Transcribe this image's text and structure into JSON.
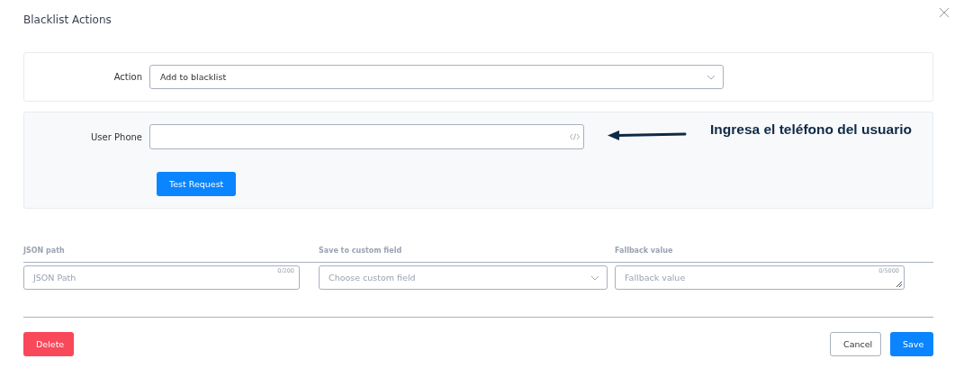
{
  "dialog": {
    "title": "Blacklist Actions"
  },
  "action": {
    "label": "Action",
    "value": "Add to blacklist"
  },
  "request": {
    "label": "User Phone",
    "button": "Test Request",
    "annotation": "Ingresa el teléfono del usuario"
  },
  "mapping": {
    "columns": [
      {
        "kind": "text",
        "label": "JSON path",
        "placeholder": "JSON Path",
        "counter": "0/200"
      },
      {
        "kind": "select",
        "label": "Save to custom field",
        "placeholder": "Choose custom field"
      },
      {
        "kind": "textarea",
        "label": "Fallback value",
        "placeholder": "Fallback value",
        "counter": "0/5000"
      }
    ]
  },
  "footer": {
    "delete": "Delete",
    "cancel": "Cancel",
    "save": "Save"
  }
}
